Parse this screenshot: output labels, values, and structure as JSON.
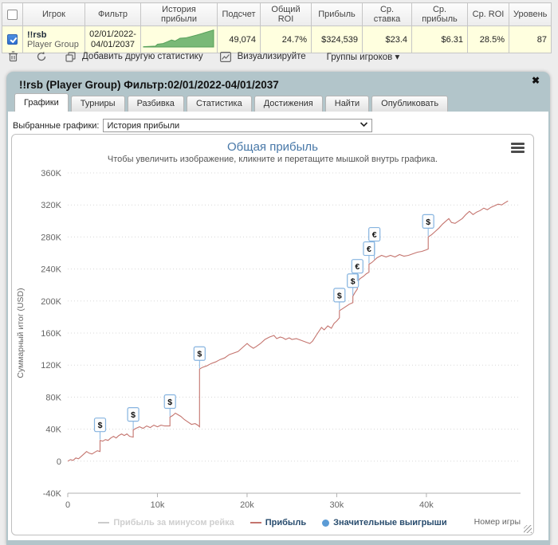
{
  "stats_table": {
    "columns": [
      "Игрок",
      "Фильтр",
      "История прибыли",
      "Подсчет",
      "Общий ROI",
      "Прибыль",
      "Ср. ставка",
      "Ср. прибыль",
      "Ср. ROI",
      "Уровень"
    ],
    "row": {
      "player": "!!rsb",
      "player_group": "Player Group",
      "filter_line1": "02/01/2022-",
      "filter_line2": "04/01/2037",
      "count": "49,074",
      "total_roi": "24.7%",
      "profit": "$324,539",
      "avg_stake": "$23.4",
      "avg_profit": "$6.31",
      "avg_roi": "28.5%",
      "level": "87"
    },
    "sparkline": {
      "fill": "#79b977",
      "stroke": "#57a05a",
      "points": [
        [
          0,
          0.02
        ],
        [
          0.17,
          0.05
        ],
        [
          0.2,
          0.16
        ],
        [
          0.28,
          0.2
        ],
        [
          0.34,
          0.3
        ],
        [
          0.4,
          0.4
        ],
        [
          0.45,
          0.34
        ],
        [
          0.52,
          0.5
        ],
        [
          0.6,
          0.52
        ],
        [
          0.68,
          0.6
        ],
        [
          0.76,
          0.68
        ],
        [
          0.86,
          0.8
        ],
        [
          1,
          0.97
        ]
      ]
    },
    "toolbar": {
      "add_stat_label": "Добавить другую статистику",
      "visualize_label": "Визуализируйте",
      "groups_label": "Группы игроков ▾"
    }
  },
  "dialog": {
    "title": "!!rsb (Player Group) Фильтр:02/01/2022-04/01/2037",
    "close_glyph": "✖",
    "tabs": [
      "Графики",
      "Турниры",
      "Разбивка",
      "Статистика",
      "Достижения",
      "Найти",
      "Опубликовать"
    ],
    "active_tab": "Графики",
    "selected_charts_label": "Выбранные графики:",
    "selected_chart_value": "История прибыли",
    "select_chevron": "⌄"
  },
  "chart_data": {
    "type": "line",
    "title": "Общая прибыль",
    "subtitle": "Чтобы увеличить изображение, кликните и перетащите мышкой внутрь графика.",
    "ylabel": "Суммарный итог (USD)",
    "xlabel": "Номер игры",
    "units_note": "x in thousands of games, y in thousands USD",
    "xlim": [
      0,
      50.5
    ],
    "ylim": [
      -40,
      360
    ],
    "ytick_values": [
      360,
      320,
      280,
      240,
      200,
      160,
      120,
      80,
      40,
      0,
      -40
    ],
    "ytick_labels": [
      "360K",
      "320K",
      "280K",
      "240K",
      "200K",
      "160K",
      "120K",
      "80K",
      "40K",
      "0",
      "-40K"
    ],
    "xtick_values": [
      0,
      10,
      20,
      30,
      40
    ],
    "xtick_labels": [
      "0",
      "10k",
      "20k",
      "30k",
      "40k"
    ],
    "grid": "dotted-horizontal",
    "legend_position": "bottom-center",
    "series": [
      {
        "name": "Прибыль за минусом рейка",
        "color": "#cccccc",
        "visible": false,
        "points": []
      },
      {
        "name": "Прибыль",
        "color": "#c4746e",
        "visible": true,
        "points": [
          [
            0,
            0
          ],
          [
            0.3,
            2
          ],
          [
            0.6,
            1
          ],
          [
            0.9,
            4
          ],
          [
            1.2,
            3
          ],
          [
            1.5,
            6
          ],
          [
            1.8,
            9
          ],
          [
            2.1,
            12
          ],
          [
            2.4,
            10
          ],
          [
            2.7,
            9
          ],
          [
            3,
            11
          ],
          [
            3.3,
            13
          ],
          [
            3.6,
            12
          ],
          [
            3.6,
            26
          ],
          [
            3.9,
            25
          ],
          [
            4.2,
            27
          ],
          [
            4.5,
            26
          ],
          [
            4.8,
            29
          ],
          [
            5.1,
            31
          ],
          [
            5.4,
            29
          ],
          [
            5.7,
            32
          ],
          [
            6,
            34
          ],
          [
            6.3,
            32
          ],
          [
            6.6,
            34
          ],
          [
            6.9,
            31
          ],
          [
            7.3,
            30
          ],
          [
            7.3,
            39
          ],
          [
            7.6,
            41
          ],
          [
            8,
            43
          ],
          [
            8.4,
            41
          ],
          [
            8.8,
            44
          ],
          [
            9.2,
            42
          ],
          [
            9.6,
            45
          ],
          [
            10,
            43
          ],
          [
            10.4,
            45
          ],
          [
            10.8,
            44
          ],
          [
            11.4,
            44
          ],
          [
            11.4,
            55
          ],
          [
            11.7,
            57
          ],
          [
            12,
            60
          ],
          [
            12.3,
            58
          ],
          [
            12.6,
            56
          ],
          [
            13,
            52
          ],
          [
            13.4,
            49
          ],
          [
            13.8,
            46
          ],
          [
            14.2,
            47
          ],
          [
            14.5,
            45
          ],
          [
            14.7,
            43
          ],
          [
            14.7,
            115
          ],
          [
            15,
            117
          ],
          [
            15.5,
            119
          ],
          [
            16,
            122
          ],
          [
            16.5,
            124
          ],
          [
            17,
            127
          ],
          [
            17.5,
            129
          ],
          [
            18,
            133
          ],
          [
            18.5,
            135
          ],
          [
            19,
            137
          ],
          [
            19.5,
            142
          ],
          [
            20,
            147
          ],
          [
            20.3,
            144
          ],
          [
            20.7,
            141
          ],
          [
            21,
            143
          ],
          [
            21.5,
            147
          ],
          [
            22,
            152
          ],
          [
            22.5,
            155
          ],
          [
            23,
            157
          ],
          [
            23.3,
            153
          ],
          [
            23.7,
            155
          ],
          [
            24,
            154
          ],
          [
            24.3,
            152
          ],
          [
            24.7,
            154
          ],
          [
            25,
            152
          ],
          [
            25.5,
            153
          ],
          [
            26,
            151
          ],
          [
            26.5,
            149
          ],
          [
            27,
            147
          ],
          [
            27.3,
            150
          ],
          [
            27.7,
            157
          ],
          [
            28,
            162
          ],
          [
            28.3,
            167
          ],
          [
            28.6,
            164
          ],
          [
            29,
            169
          ],
          [
            29.4,
            166
          ],
          [
            29.7,
            172
          ],
          [
            30,
            175
          ],
          [
            30.3,
            179
          ],
          [
            30.3,
            188
          ],
          [
            30.6,
            190
          ],
          [
            31,
            193
          ],
          [
            31.4,
            196
          ],
          [
            31.8,
            198
          ],
          [
            31.8,
            206
          ],
          [
            32,
            210
          ],
          [
            32.3,
            215
          ],
          [
            32.3,
            224
          ],
          [
            32.6,
            228
          ],
          [
            33,
            231
          ],
          [
            33.3,
            234
          ],
          [
            33.6,
            236
          ],
          [
            33.6,
            246
          ],
          [
            33.9,
            248
          ],
          [
            34.2,
            251
          ],
          [
            34.5,
            254
          ],
          [
            35,
            257
          ],
          [
            35.5,
            255
          ],
          [
            36,
            257
          ],
          [
            36.5,
            255
          ],
          [
            37,
            258
          ],
          [
            37.5,
            256
          ],
          [
            38,
            257
          ],
          [
            38.5,
            259
          ],
          [
            39,
            261
          ],
          [
            39.5,
            262
          ],
          [
            40,
            264
          ],
          [
            40.2,
            265
          ],
          [
            40.2,
            280
          ],
          [
            40.6,
            283
          ],
          [
            41,
            287
          ],
          [
            41.4,
            291
          ],
          [
            41.8,
            296
          ],
          [
            42.2,
            300
          ],
          [
            42.5,
            303
          ],
          [
            42.8,
            298
          ],
          [
            43.2,
            297
          ],
          [
            43.6,
            300
          ],
          [
            44,
            303
          ],
          [
            44.4,
            308
          ],
          [
            44.8,
            312
          ],
          [
            45.2,
            308
          ],
          [
            45.6,
            311
          ],
          [
            46,
            313
          ],
          [
            46.4,
            316
          ],
          [
            46.8,
            314
          ],
          [
            47.2,
            317
          ],
          [
            47.6,
            319
          ],
          [
            48,
            321
          ],
          [
            48.4,
            320
          ],
          [
            48.8,
            323
          ],
          [
            49.1,
            325
          ]
        ]
      }
    ],
    "flags_series": {
      "name": "Значительные выигрыши",
      "color": "#5b9bd5",
      "flag_border": "#86b4e0",
      "flags": [
        {
          "x": 3.6,
          "y": 26,
          "symbol": "$"
        },
        {
          "x": 7.3,
          "y": 39,
          "symbol": "$"
        },
        {
          "x": 11.4,
          "y": 55,
          "symbol": "$"
        },
        {
          "x": 14.7,
          "y": 115,
          "symbol": "$"
        },
        {
          "x": 30.3,
          "y": 188,
          "symbol": "$"
        },
        {
          "x": 31.8,
          "y": 206,
          "symbol": "$"
        },
        {
          "x": 32.3,
          "y": 224,
          "symbol": "€"
        },
        {
          "x": 33.6,
          "y": 246,
          "symbol": "€"
        },
        {
          "x": 34.2,
          "y": 251,
          "symbol": "€"
        },
        {
          "x": 40.2,
          "y": 280,
          "symbol": "$"
        }
      ]
    }
  }
}
